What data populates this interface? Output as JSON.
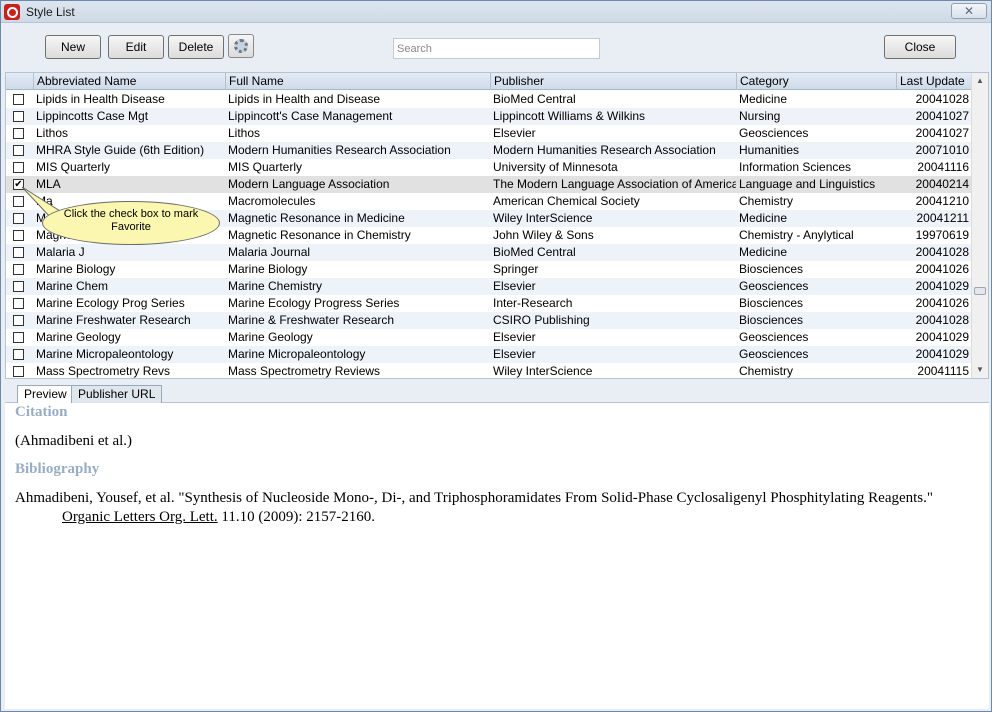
{
  "window": {
    "title": "Style List",
    "close_glyph": "✕"
  },
  "toolbar": {
    "new_label": "New",
    "edit_label": "Edit",
    "delete_label": "Delete",
    "close_label": "Close",
    "search_placeholder": "Search"
  },
  "table": {
    "columns": [
      "Abbreviated Name",
      "Full Name",
      "Publisher",
      "Category",
      "Last Update"
    ],
    "rows": [
      {
        "checked": false,
        "abbr": "Lipids in Health Disease",
        "full": "Lipids in Health and Disease",
        "publisher": "BioMed Central",
        "category": "Medicine",
        "updated": "20041028"
      },
      {
        "checked": false,
        "abbr": "Lippincotts Case Mgt",
        "full": "Lippincott's Case Management",
        "publisher": "Lippincott Williams & Wilkins",
        "category": "Nursing",
        "updated": "20041027"
      },
      {
        "checked": false,
        "abbr": "Lithos",
        "full": "Lithos",
        "publisher": "Elsevier",
        "category": "Geosciences",
        "updated": "20041027"
      },
      {
        "checked": false,
        "abbr": "MHRA Style Guide (6th Edition)",
        "full": "Modern Humanities Research Association",
        "publisher": "Modern Humanities Research Association",
        "category": "Humanities",
        "updated": "20071010"
      },
      {
        "checked": false,
        "abbr": "MIS Quarterly",
        "full": "MIS Quarterly",
        "publisher": "University of Minnesota",
        "category": "Information Sciences",
        "updated": "20041116"
      },
      {
        "checked": true,
        "abbr": "MLA",
        "full": "Modern Language Association",
        "publisher": "The Modern Language Association of America",
        "category": "Language and Linguistics",
        "updated": "20040214"
      },
      {
        "checked": false,
        "abbr": "Ma",
        "full": "Macromolecules",
        "publisher": "American Chemical Society",
        "category": "Chemistry",
        "updated": "20041210"
      },
      {
        "checked": false,
        "abbr": "Mc",
        "full": "Magnetic Resonance in Medicine",
        "publisher": "Wiley InterScience",
        "category": "Medicine",
        "updated": "20041211"
      },
      {
        "checked": false,
        "abbr": "Magne",
        "full": "Magnetic Resonance in Chemistry",
        "publisher": "John Wiley & Sons",
        "category": "Chemistry - Anylytical",
        "updated": "19970619"
      },
      {
        "checked": false,
        "abbr": "Malaria J",
        "full": "Malaria Journal",
        "publisher": "BioMed Central",
        "category": "Medicine",
        "updated": "20041028"
      },
      {
        "checked": false,
        "abbr": "Marine Biology",
        "full": "Marine Biology",
        "publisher": "Springer",
        "category": "Biosciences",
        "updated": "20041026"
      },
      {
        "checked": false,
        "abbr": "Marine Chem",
        "full": "Marine Chemistry",
        "publisher": "Elsevier",
        "category": "Geosciences",
        "updated": "20041029"
      },
      {
        "checked": false,
        "abbr": "Marine Ecology Prog Series",
        "full": "Marine Ecology Progress Series",
        "publisher": "Inter-Research",
        "category": "Biosciences",
        "updated": "20041026"
      },
      {
        "checked": false,
        "abbr": "Marine Freshwater Research",
        "full": "Marine & Freshwater Research",
        "publisher": "CSIRO Publishing",
        "category": "Biosciences",
        "updated": "20041028"
      },
      {
        "checked": false,
        "abbr": "Marine Geology",
        "full": "Marine Geology",
        "publisher": "Elsevier",
        "category": "Geosciences",
        "updated": "20041029"
      },
      {
        "checked": false,
        "abbr": "Marine Micropaleontology",
        "full": "Marine Micropaleontology",
        "publisher": "Elsevier",
        "category": "Geosciences",
        "updated": "20041029"
      },
      {
        "checked": false,
        "abbr": "Mass Spectrometry Revs",
        "full": "Mass Spectrometry Reviews",
        "publisher": "Wiley InterScience",
        "category": "Chemistry",
        "updated": "20041115"
      }
    ]
  },
  "callout": {
    "text": "Click the check box to mark Favorite"
  },
  "tabs": [
    "Preview",
    "Publisher URL"
  ],
  "preview": {
    "citation_heading": "Citation",
    "citation_text": "(Ahmadibeni et al.)",
    "bibliography_heading": "Bibliography",
    "bib_part1": "Ahmadibeni, Yousef, et al. \"Synthesis of Nucleoside Mono-, Di-, and Triphosphoramidates From Solid-Phase Cyclosaligenyl Phosphitylating Reagents.\" ",
    "bib_journal": "Organic Letters Org. Lett.",
    "bib_part2": " 11.10 (2009): 2157-2160."
  }
}
